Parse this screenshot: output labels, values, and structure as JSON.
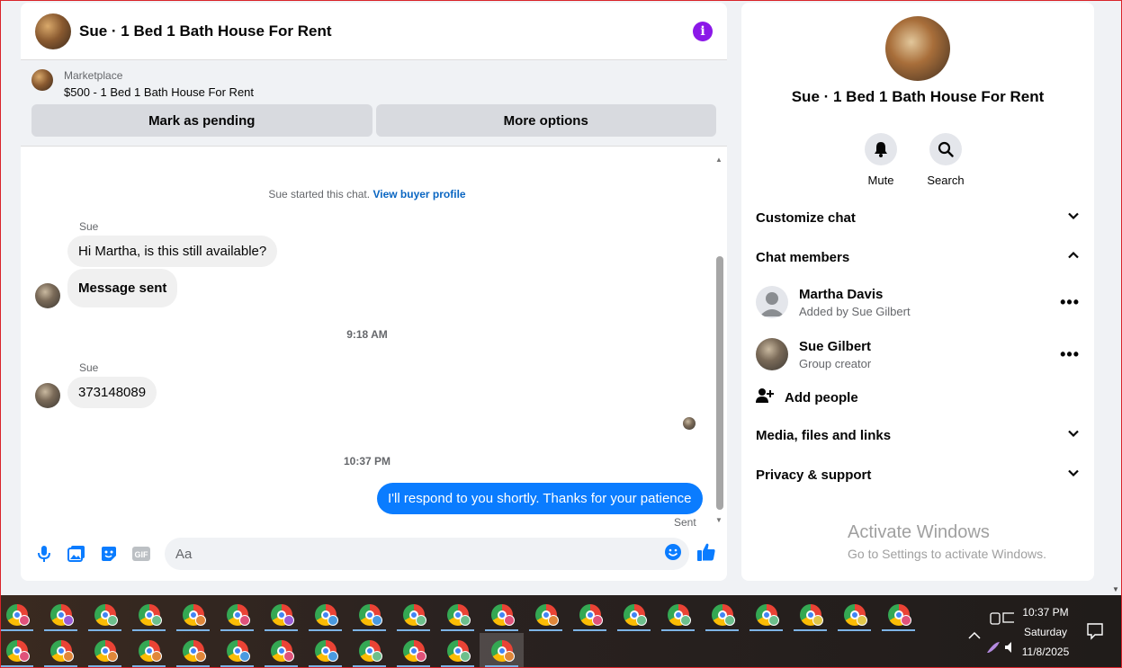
{
  "chat": {
    "title": "Sue · 1 Bed 1 Bath House For Rent",
    "marketplace_label": "Marketplace",
    "listing": "$500 - 1 Bed 1 Bath House For Rent",
    "mark_pending": "Mark as pending",
    "more_options": "More options",
    "system_text": "Sue started this chat.",
    "view_profile": "View buyer profile",
    "messages": [
      {
        "sender": "Sue",
        "text": "Hi Martha, is this still available?"
      },
      {
        "text": "Message sent"
      },
      {
        "time": "9:18 AM"
      },
      {
        "sender": "Sue",
        "text": "373148089"
      },
      {
        "time": "10:37 PM"
      },
      {
        "text": "I'll respond to you shortly. Thanks for your patience",
        "outgoing": true,
        "status": "Sent"
      }
    ],
    "composer_placeholder": "Aa"
  },
  "side": {
    "title": "Sue · 1 Bed 1 Bath House For Rent",
    "mute": "Mute",
    "search": "Search",
    "customize": "Customize chat",
    "members_header": "Chat members",
    "members": [
      {
        "name": "Martha Davis",
        "sub": "Added by Sue Gilbert"
      },
      {
        "name": "Sue Gilbert",
        "sub": "Group creator"
      }
    ],
    "add_people": "Add people",
    "media": "Media, files and links",
    "privacy": "Privacy & support",
    "activate_title": "Activate Windows",
    "activate_sub": "Go to Settings to activate Windows."
  },
  "taskbar": {
    "time": "10:37 PM",
    "day": "Saturday",
    "date": "11/8/2025",
    "row1_badges": [
      "#e0527a",
      "#9a5bd6",
      "#6dbf8c",
      "#6dbf8c",
      "#e0873a",
      "#e0527a",
      "#9a5bd6",
      "#4a9ae0",
      "#4a9ae0",
      "#6dbf8c",
      "#6dbf8c",
      "#e0527a",
      "#e0873a",
      "#e0527a",
      "#6dbf8c",
      "#6dbf8c",
      "#6dbf8c",
      "#6dbf8c",
      "#e0c64a",
      "#e0c64a",
      "#e0527a"
    ],
    "row2_badges": [
      "#e0527a",
      "#e0873a",
      "#e0873a",
      "#e0873a",
      "#e0873a",
      "#4a9ae0",
      "#e0527a",
      "#4a9ae0",
      "#6dbf8c",
      "#e0527a",
      "#6dbf8c",
      "#e0873a"
    ]
  }
}
